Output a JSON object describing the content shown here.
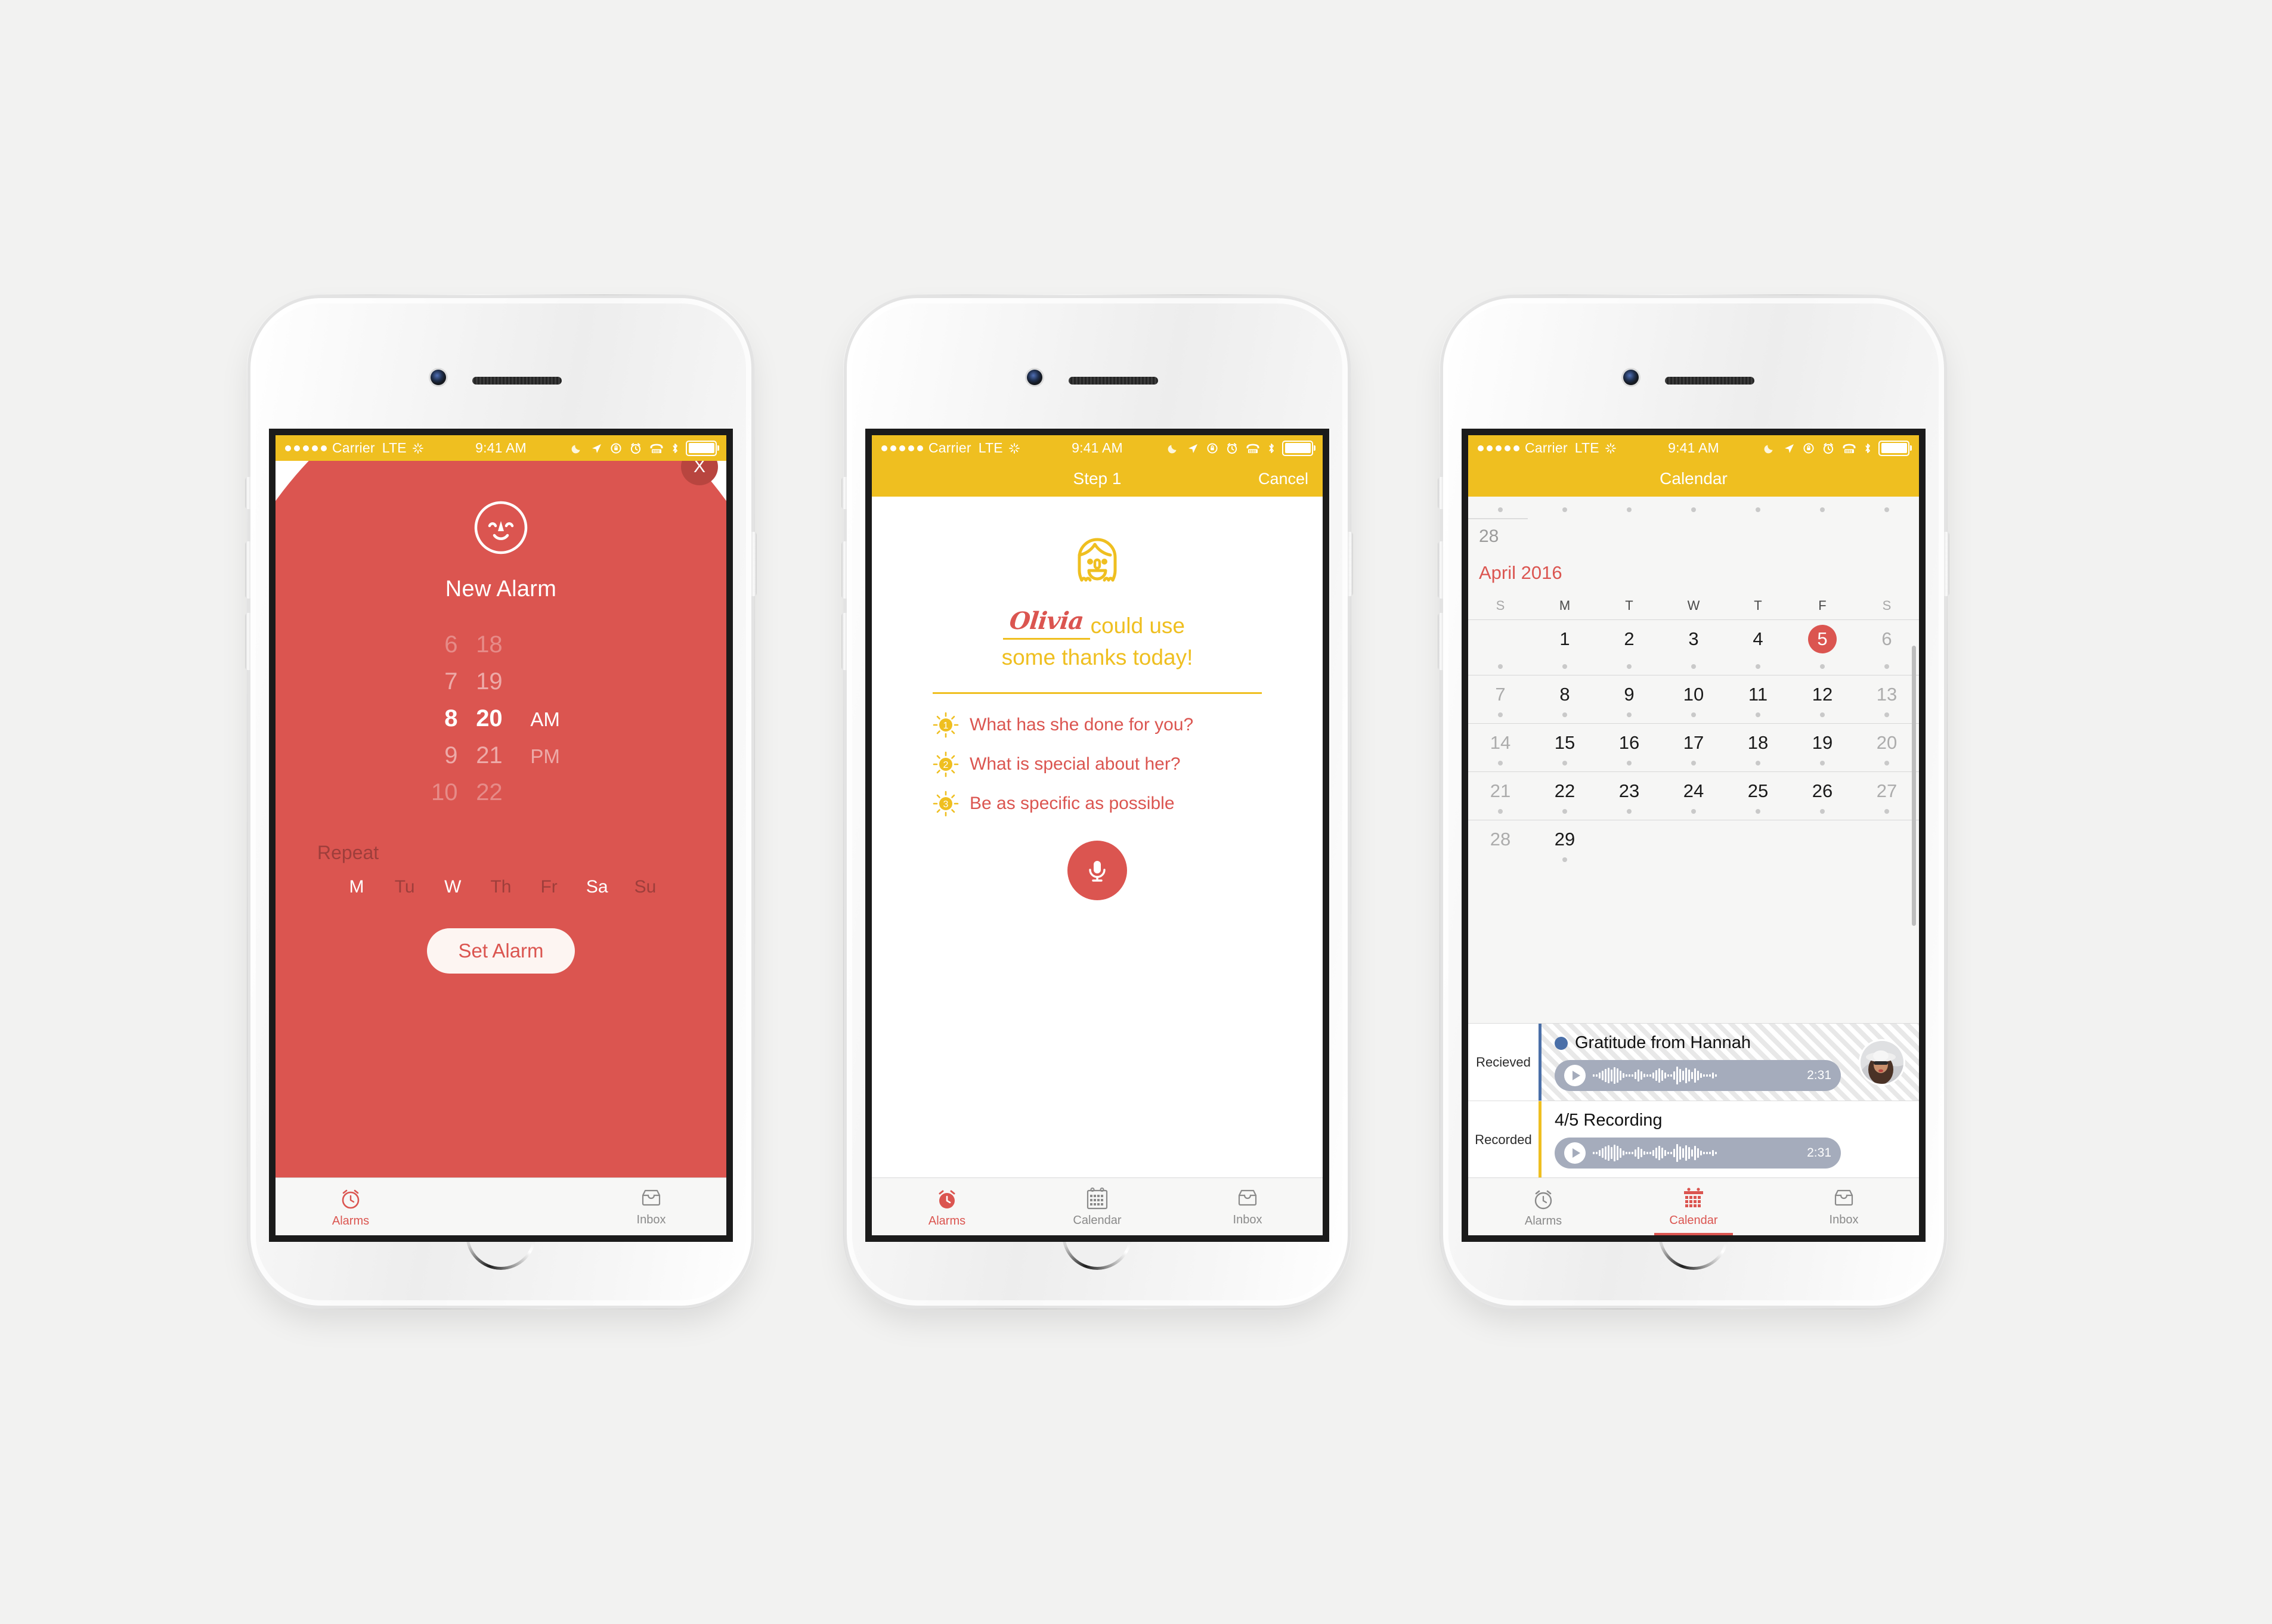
{
  "colors": {
    "red": "#db5550",
    "yellow": "#efbf20",
    "dark_red": "#b8453f",
    "blue": "#4a6fa8",
    "screen_bg": "#f6f6f5"
  },
  "status_bar": {
    "carrier": "Carrier",
    "network": "LTE",
    "time": "9:41 AM",
    "icons": [
      "signal-dots-icon",
      "activity-icon",
      "moon-icon",
      "location-arrow-icon",
      "rotation-lock-icon",
      "alarm-clock-icon",
      "tty-icon",
      "bluetooth-icon",
      "battery-icon"
    ]
  },
  "phone1": {
    "close_label": "X",
    "title": "New Alarm",
    "face_icon": "smiley-face-icon",
    "picker": {
      "rows": [
        {
          "hour": "6",
          "minute": "18",
          "period": ""
        },
        {
          "hour": "7",
          "minute": "19",
          "period": ""
        },
        {
          "hour": "8",
          "minute": "20",
          "period": "AM"
        },
        {
          "hour": "9",
          "minute": "21",
          "period": "PM"
        },
        {
          "hour": "10",
          "minute": "22",
          "period": ""
        }
      ],
      "selected_hour": "8",
      "selected_minute": "20",
      "selected_period": "AM"
    },
    "repeat_label": "Repeat",
    "days": [
      {
        "label": "M",
        "selected": true
      },
      {
        "label": "Tu",
        "selected": false
      },
      {
        "label": "W",
        "selected": true
      },
      {
        "label": "Th",
        "selected": false
      },
      {
        "label": "Fr",
        "selected": false
      },
      {
        "label": "Sa",
        "selected": true
      },
      {
        "label": "Su",
        "selected": false
      }
    ],
    "set_alarm_label": "Set Alarm",
    "tabs": [
      {
        "label": "Alarms",
        "icon": "alarm-clock-icon",
        "active": true
      },
      {
        "label": "",
        "icon": "",
        "active": false
      },
      {
        "label": "Inbox",
        "icon": "inbox-tray-icon",
        "active": false
      }
    ]
  },
  "phone2": {
    "nav_title": "Step 1",
    "cancel_label": "Cancel",
    "girl_icon": "girl-face-icon",
    "person_name": "Olivia",
    "headline_part1": "could use",
    "headline_part2": "some thanks today!",
    "tips": [
      {
        "number": "1",
        "text": "What has she done for you?"
      },
      {
        "number": "2",
        "text": "What is special about her?"
      },
      {
        "number": "3",
        "text": "Be as specific as possible"
      }
    ],
    "mic_icon": "microphone-icon",
    "tabs": [
      {
        "label": "Alarms",
        "icon": "alarm-clock-icon",
        "active": true
      },
      {
        "label": "Calendar",
        "icon": "calendar-grid-icon",
        "active": false
      },
      {
        "label": "Inbox",
        "icon": "inbox-tray-icon",
        "active": false
      }
    ]
  },
  "phone3": {
    "nav_title": "Calendar",
    "prev_month_day": "28",
    "month_label": "April 2016",
    "day_headers": [
      "S",
      "M",
      "T",
      "W",
      "T",
      "F",
      "S"
    ],
    "weeks": [
      {
        "days": [
          {
            "n": "",
            "mut": true
          },
          {
            "n": "1",
            "mut": false
          },
          {
            "n": "2",
            "mut": false
          },
          {
            "n": "3",
            "mut": false
          },
          {
            "n": "4",
            "mut": false
          },
          {
            "n": "5",
            "mut": false,
            "today": true
          },
          {
            "n": "6",
            "mut": true
          }
        ]
      },
      {
        "days": [
          {
            "n": "7",
            "mut": true
          },
          {
            "n": "8",
            "mut": false
          },
          {
            "n": "9",
            "mut": false
          },
          {
            "n": "10",
            "mut": false
          },
          {
            "n": "11",
            "mut": false
          },
          {
            "n": "12",
            "mut": false
          },
          {
            "n": "13",
            "mut": true
          }
        ]
      },
      {
        "days": [
          {
            "n": "14",
            "mut": true
          },
          {
            "n": "15",
            "mut": false
          },
          {
            "n": "16",
            "mut": false
          },
          {
            "n": "17",
            "mut": false
          },
          {
            "n": "18",
            "mut": false
          },
          {
            "n": "19",
            "mut": false
          },
          {
            "n": "20",
            "mut": true
          }
        ]
      },
      {
        "days": [
          {
            "n": "21",
            "mut": true
          },
          {
            "n": "22",
            "mut": false
          },
          {
            "n": "23",
            "mut": false
          },
          {
            "n": "24",
            "mut": false
          },
          {
            "n": "25",
            "mut": false
          },
          {
            "n": "26",
            "mut": false
          },
          {
            "n": "27",
            "mut": true
          }
        ]
      },
      {
        "days": [
          {
            "n": "28",
            "mut": true
          },
          {
            "n": "29",
            "mut": false
          },
          {
            "n": "",
            "mut": false
          },
          {
            "n": "",
            "mut": false
          },
          {
            "n": "",
            "mut": false
          },
          {
            "n": "",
            "mut": false
          },
          {
            "n": "",
            "mut": false
          }
        ]
      }
    ],
    "events": [
      {
        "label": "Recieved",
        "title": "Gratitude from Hannah",
        "duration": "2:31",
        "accent": "#4a6fa8",
        "has_avatar": true,
        "has_dot": true
      },
      {
        "label": "Recorded",
        "title": "4/5 Recording",
        "duration": "2:31",
        "accent": "#efbf20",
        "has_avatar": false,
        "has_dot": false
      }
    ],
    "tabs": [
      {
        "label": "Alarms",
        "icon": "alarm-clock-icon",
        "active": false
      },
      {
        "label": "Calendar",
        "icon": "calendar-grid-icon",
        "active": true
      },
      {
        "label": "Inbox",
        "icon": "inbox-tray-icon",
        "active": false
      }
    ]
  }
}
